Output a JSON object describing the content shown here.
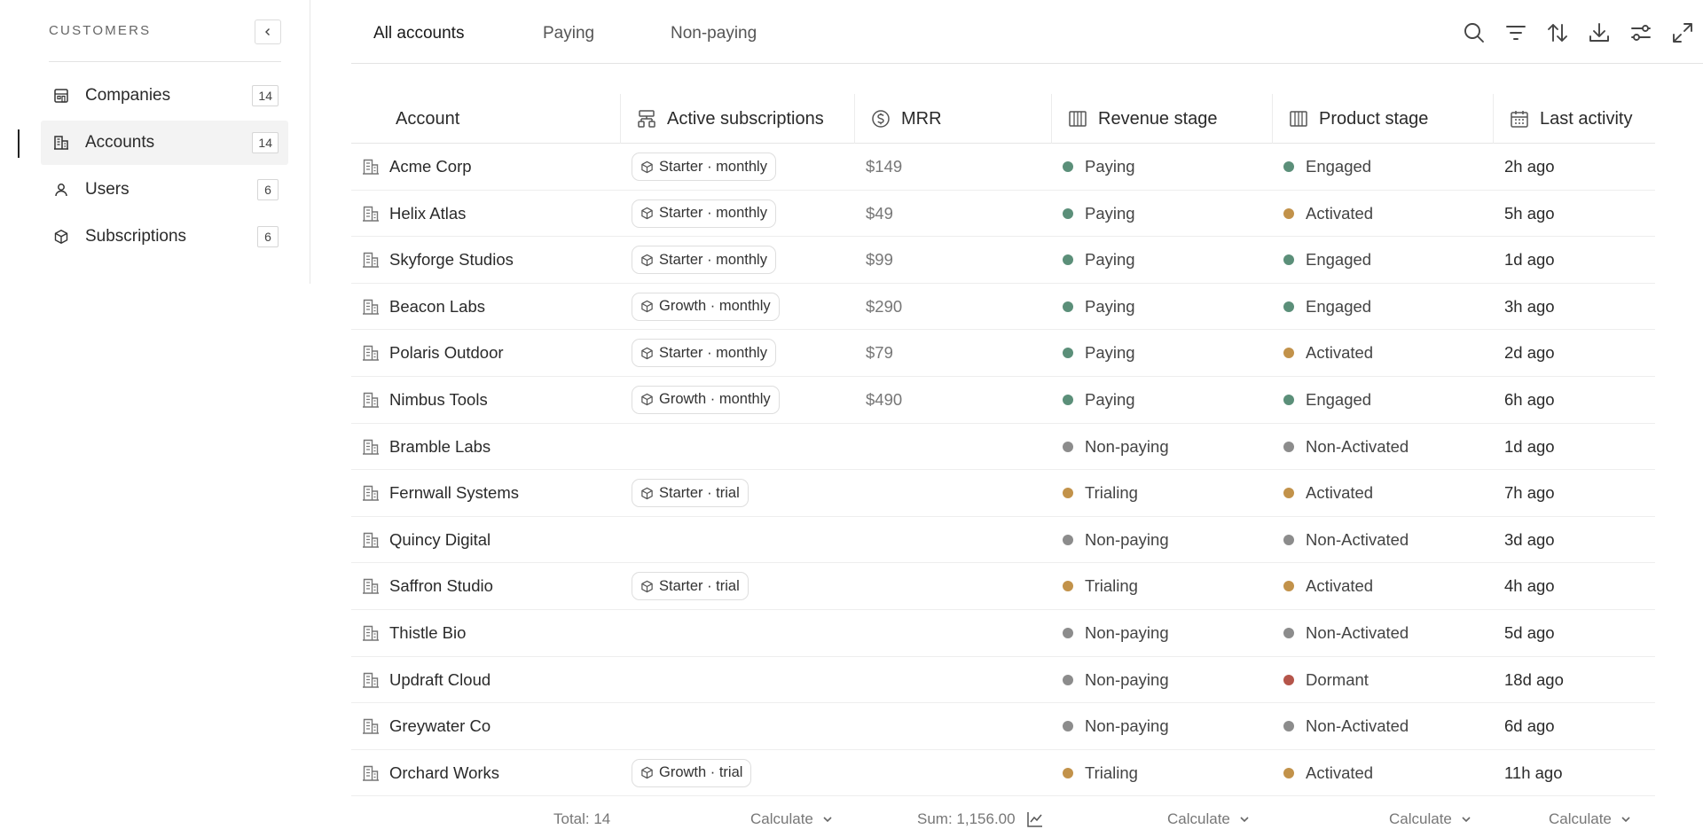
{
  "sidebar": {
    "title": "CUSTOMERS",
    "items": [
      {
        "label": "Companies",
        "count": "14",
        "icon": "building-icon"
      },
      {
        "label": "Accounts",
        "count": "14",
        "icon": "office-icon"
      },
      {
        "label": "Users",
        "count": "6",
        "icon": "user-icon"
      },
      {
        "label": "Subscriptions",
        "count": "6",
        "icon": "cube-icon"
      }
    ]
  },
  "tabs": [
    "All accounts",
    "Paying",
    "Non-paying"
  ],
  "columns": [
    "Account",
    "Active subscriptions",
    "MRR",
    "Revenue stage",
    "Product stage",
    "Last activity"
  ],
  "colors": {
    "green": "#5b8f79",
    "amber": "#c2924a",
    "gray": "#8c8c8c",
    "red": "#b5554a"
  },
  "rows": [
    {
      "account": "Acme Corp",
      "sub": "Starter · monthly",
      "mrr": "$149",
      "rev": "Paying",
      "rev_color": "green",
      "prod": "Engaged",
      "prod_color": "green",
      "last": "2h ago"
    },
    {
      "account": "Helix Atlas",
      "sub": "Starter · monthly",
      "mrr": "$49",
      "rev": "Paying",
      "rev_color": "green",
      "prod": "Activated",
      "prod_color": "amber",
      "last": "5h ago"
    },
    {
      "account": "Skyforge Studios",
      "sub": "Starter · monthly",
      "mrr": "$99",
      "rev": "Paying",
      "rev_color": "green",
      "prod": "Engaged",
      "prod_color": "green",
      "last": "1d ago"
    },
    {
      "account": "Beacon Labs",
      "sub": "Growth · monthly",
      "mrr": "$290",
      "rev": "Paying",
      "rev_color": "green",
      "prod": "Engaged",
      "prod_color": "green",
      "last": "3h ago"
    },
    {
      "account": "Polaris Outdoor",
      "sub": "Starter · monthly",
      "mrr": "$79",
      "rev": "Paying",
      "rev_color": "green",
      "prod": "Activated",
      "prod_color": "amber",
      "last": "2d ago"
    },
    {
      "account": "Nimbus Tools",
      "sub": "Growth · monthly",
      "mrr": "$490",
      "rev": "Paying",
      "rev_color": "green",
      "prod": "Engaged",
      "prod_color": "green",
      "last": "6h ago"
    },
    {
      "account": "Bramble Labs",
      "sub": "",
      "mrr": "",
      "rev": "Non-paying",
      "rev_color": "gray",
      "prod": "Non-Activated",
      "prod_color": "gray",
      "last": "1d ago"
    },
    {
      "account": "Fernwall Systems",
      "sub": "Starter · trial",
      "mrr": "",
      "rev": "Trialing",
      "rev_color": "amber",
      "prod": "Activated",
      "prod_color": "amber",
      "last": "7h ago"
    },
    {
      "account": "Quincy Digital",
      "sub": "",
      "mrr": "",
      "rev": "Non-paying",
      "rev_color": "gray",
      "prod": "Non-Activated",
      "prod_color": "gray",
      "last": "3d ago"
    },
    {
      "account": "Saffron Studio",
      "sub": "Starter · trial",
      "mrr": "",
      "rev": "Trialing",
      "rev_color": "amber",
      "prod": "Activated",
      "prod_color": "amber",
      "last": "4h ago"
    },
    {
      "account": "Thistle Bio",
      "sub": "",
      "mrr": "",
      "rev": "Non-paying",
      "rev_color": "gray",
      "prod": "Non-Activated",
      "prod_color": "gray",
      "last": "5d ago"
    },
    {
      "account": "Updraft Cloud",
      "sub": "",
      "mrr": "",
      "rev": "Non-paying",
      "rev_color": "gray",
      "prod": "Dormant",
      "prod_color": "red",
      "last": "18d ago"
    },
    {
      "account": "Greywater Co",
      "sub": "",
      "mrr": "",
      "rev": "Non-paying",
      "rev_color": "gray",
      "prod": "Non-Activated",
      "prod_color": "gray",
      "last": "6d ago"
    },
    {
      "account": "Orchard Works",
      "sub": "Growth · trial",
      "mrr": "",
      "rev": "Trialing",
      "rev_color": "amber",
      "prod": "Activated",
      "prod_color": "amber",
      "last": "11h ago"
    }
  ],
  "footer": {
    "total": "Total: 14",
    "calc_sub": "Calculate",
    "sum": "Sum: 1,156.00",
    "calc_rev": "Calculate",
    "calc_prod": "Calculate",
    "calc_last": "Calculate"
  }
}
